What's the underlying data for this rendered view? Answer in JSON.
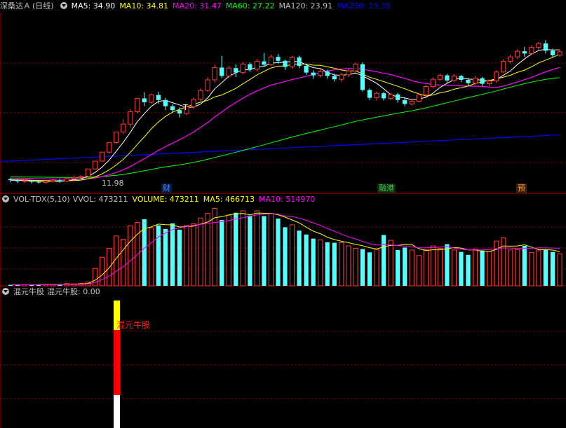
{
  "panel1": {
    "stock_name": "深桑达Ａ",
    "period": "(日线)",
    "ma": [
      {
        "label": "MA5: 34.90",
        "color": "#ffffff"
      },
      {
        "label": "MA10: 34.81",
        "color": "#ffff00"
      },
      {
        "label": "MA20: 31.47",
        "color": "#ff00ff"
      },
      {
        "label": "MA60: 27.22",
        "color": "#00ff00"
      },
      {
        "label": "MA120: 23.91",
        "color": "#c0c0c0"
      },
      {
        "label": "MA250: 19.39",
        "color": "#0000ff"
      }
    ],
    "low_label": "11.98",
    "events": [
      {
        "label": "财",
        "color": "#3c8cff"
      },
      {
        "label": "融港",
        "color": "#40c040"
      },
      {
        "label": "预",
        "color": "#ff9030"
      }
    ],
    "t_marker": "T"
  },
  "panel2": {
    "name": "VOL-TDX(5,10)",
    "vvol": "VVOL: 473211",
    "volume": "VOLUME: 473211",
    "ma5": "MA5: 466713",
    "ma10": "MA10: 514970"
  },
  "panel3": {
    "name": "混元牛股",
    "value_label": "混元牛股: 0.00",
    "bar_text": "混元牛股"
  },
  "colors": {
    "up": "#ff3c3c",
    "down": "#54ffff",
    "grid": "#8b0000",
    "ma5": "#ffffff",
    "ma10": "#ffff00",
    "ma20": "#ff00ff",
    "ma60": "#00ff00",
    "ma120": "#c0c0c0",
    "ma250": "#0000ff"
  },
  "chart_data": {
    "type": "candlestick",
    "ohlc": [
      [
        12.8,
        12.6,
        12.2,
        13.0
      ],
      [
        12.6,
        12.4,
        12.1,
        12.8
      ],
      [
        12.4,
        12.5,
        12.1,
        12.7
      ],
      [
        12.5,
        12.3,
        12.0,
        12.6
      ],
      [
        12.3,
        12.2,
        11.98,
        12.5
      ],
      [
        12.2,
        12.4,
        12.0,
        12.6
      ],
      [
        12.4,
        12.6,
        12.2,
        12.8
      ],
      [
        12.6,
        12.4,
        12.1,
        12.9
      ],
      [
        12.4,
        12.9,
        12.2,
        13.1
      ],
      [
        12.9,
        13.1,
        12.7,
        13.4
      ],
      [
        13.1,
        13.3,
        12.9,
        13.5
      ],
      [
        13.3,
        14.6,
        13.2,
        14.6
      ],
      [
        14.6,
        16.0,
        14.5,
        16.0
      ],
      [
        16.0,
        17.6,
        15.9,
        17.6
      ],
      [
        17.6,
        19.3,
        17.4,
        19.3
      ],
      [
        19.3,
        21.2,
        19.0,
        21.2
      ],
      [
        21.2,
        22.6,
        20.8,
        23.5
      ],
      [
        22.6,
        24.8,
        22.0,
        25.3
      ],
      [
        24.8,
        27.2,
        24.5,
        27.3
      ],
      [
        27.2,
        26.5,
        25.8,
        28.3
      ],
      [
        26.5,
        27.8,
        26.2,
        28.1
      ],
      [
        27.8,
        26.9,
        26.2,
        28.4
      ],
      [
        26.9,
        25.8,
        25.1,
        27.3
      ],
      [
        25.8,
        25.1,
        24.6,
        26.2
      ],
      [
        25.1,
        24.5,
        23.8,
        25.6
      ],
      [
        24.5,
        25.7,
        24.2,
        26.1
      ],
      [
        25.7,
        27.0,
        25.3,
        27.4
      ],
      [
        27.0,
        28.6,
        26.7,
        29.0
      ],
      [
        28.6,
        30.5,
        28.4,
        31.0
      ],
      [
        30.5,
        32.7,
        30.0,
        33.2
      ],
      [
        32.7,
        31.2,
        30.8,
        34.8
      ],
      [
        31.2,
        32.6,
        30.9,
        33.0
      ],
      [
        32.6,
        31.8,
        31.0,
        33.3
      ],
      [
        31.8,
        33.3,
        31.5,
        33.7
      ],
      [
        33.3,
        32.4,
        31.9,
        33.6
      ],
      [
        32.4,
        33.8,
        32.0,
        34.2
      ],
      [
        33.8,
        33.2,
        32.8,
        35.3
      ],
      [
        33.2,
        34.6,
        33.0,
        35.0
      ],
      [
        34.6,
        33.9,
        33.4,
        35.1
      ],
      [
        33.9,
        32.8,
        32.3,
        34.1
      ],
      [
        32.8,
        34.5,
        32.5,
        34.8
      ],
      [
        34.5,
        33.0,
        32.6,
        34.8
      ],
      [
        33.0,
        31.8,
        31.4,
        33.3
      ],
      [
        31.8,
        31.3,
        30.7,
        32.2
      ],
      [
        31.3,
        32.0,
        30.9,
        32.4
      ],
      [
        32.0,
        31.2,
        30.7,
        32.3
      ],
      [
        31.2,
        30.6,
        30.2,
        31.6
      ],
      [
        30.6,
        31.4,
        30.2,
        31.8
      ],
      [
        31.4,
        32.1,
        31.0,
        32.5
      ],
      [
        32.1,
        33.3,
        31.9,
        33.6
      ],
      [
        33.3,
        28.7,
        28.4,
        33.6
      ],
      [
        28.7,
        27.3,
        26.9,
        29.0
      ],
      [
        27.3,
        28.1,
        26.8,
        28.4
      ],
      [
        28.1,
        27.2,
        26.8,
        28.4
      ],
      [
        27.2,
        27.9,
        26.9,
        28.2
      ],
      [
        27.9,
        26.9,
        26.4,
        28.2
      ],
      [
        26.9,
        26.2,
        25.8,
        27.3
      ],
      [
        26.2,
        26.7,
        25.9,
        27.0
      ],
      [
        26.7,
        27.8,
        26.5,
        28.1
      ],
      [
        27.8,
        29.3,
        27.5,
        29.7
      ],
      [
        29.3,
        30.6,
        29.0,
        31.0
      ],
      [
        30.6,
        31.3,
        30.3,
        31.7
      ],
      [
        31.3,
        30.4,
        30.0,
        31.6
      ],
      [
        30.4,
        31.2,
        30.1,
        31.5
      ],
      [
        31.2,
        30.5,
        30.1,
        31.4
      ],
      [
        30.5,
        29.9,
        29.5,
        30.8
      ],
      [
        29.9,
        30.8,
        29.6,
        31.2
      ],
      [
        30.8,
        29.8,
        29.4,
        31.0
      ],
      [
        29.8,
        30.3,
        29.4,
        30.6
      ],
      [
        30.3,
        31.9,
        30.0,
        32.2
      ],
      [
        31.9,
        33.8,
        31.7,
        34.2
      ],
      [
        33.8,
        34.6,
        33.4,
        35.0
      ],
      [
        34.6,
        35.6,
        34.2,
        36.0
      ],
      [
        35.6,
        35.2,
        34.6,
        36.4
      ],
      [
        35.2,
        36.3,
        34.9,
        36.7
      ],
      [
        36.3,
        37.0,
        35.9,
        37.3
      ],
      [
        37.0,
        35.7,
        35.2,
        37.6
      ],
      [
        35.7,
        34.9,
        34.4,
        36.1
      ],
      [
        34.9,
        35.5,
        34.6,
        35.9
      ]
    ],
    "volume": [
      4200,
      4000,
      4800,
      4400,
      6000,
      4800,
      5500,
      5300,
      9500,
      8000,
      10500,
      15000,
      72000,
      118000,
      155000,
      206000,
      192000,
      248000,
      262000,
      275000,
      240000,
      250000,
      235000,
      258000,
      232000,
      250000,
      256000,
      280000,
      300000,
      320000,
      272000,
      292000,
      302000,
      310000,
      290000,
      310000,
      288000,
      300000,
      278000,
      242000,
      252000,
      228000,
      212000,
      195000,
      190000,
      180000,
      178000,
      178000,
      165000,
      155000,
      152000,
      138000,
      150000,
      210000,
      188000,
      148000,
      158000,
      148000,
      125000,
      150000,
      165000,
      155000,
      172000,
      148000,
      140000,
      128000,
      152000,
      146000,
      142000,
      185000,
      198000,
      148000,
      150000,
      165000,
      138000,
      145000,
      150000,
      140000,
      132000
    ],
    "volume_ylim": [
      0,
      330000
    ],
    "price_ylim": [
      11.0,
      42.0
    ],
    "hunyuan_value": 0.0
  }
}
